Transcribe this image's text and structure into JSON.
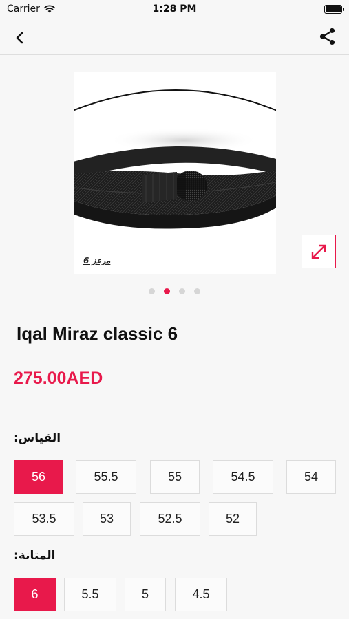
{
  "status_bar": {
    "carrier": "Carrier",
    "time": "1:28 PM"
  },
  "nav": {
    "back_icon": "chevron-left-icon",
    "share_icon": "share-icon"
  },
  "image": {
    "caption": "مرعز 6",
    "expand_icon": "expand-icon",
    "pages": 4,
    "active_page": 2
  },
  "product": {
    "title": "Iqal Miraz classic 6",
    "price": "275.00AED"
  },
  "options": {
    "size_label": "القياس:",
    "sizes": [
      "56",
      "55.5",
      "55",
      "54.5",
      "54",
      "53.5",
      "53",
      "52.5",
      "52"
    ],
    "selected_size": "56",
    "strength_label": "المتانة:",
    "strengths": [
      "6",
      "5.5",
      "5",
      "4.5"
    ],
    "selected_strength": "6"
  },
  "colors": {
    "accent": "#e8194b",
    "background": "#f7f7f7",
    "option_border": "#dcdcdc"
  }
}
